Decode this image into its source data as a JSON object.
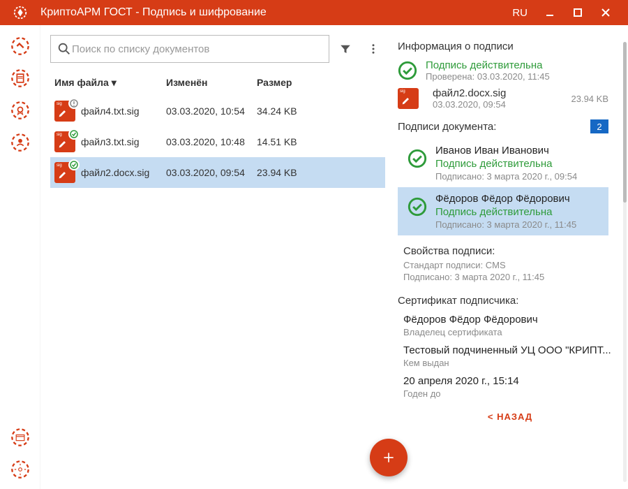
{
  "window": {
    "title": "КриптоАРМ ГОСТ - Подпись и шифрование",
    "language": "RU"
  },
  "search": {
    "placeholder": "Поиск по списку документов"
  },
  "columns": {
    "name": "Имя файла",
    "modified": "Изменён",
    "size": "Размер"
  },
  "files": [
    {
      "name": "файл4.txt.sig",
      "modified": "03.03.2020, 10:54",
      "size": "34.24 KB",
      "status": "unknown"
    },
    {
      "name": "файл3.txt.sig",
      "modified": "03.03.2020, 10:48",
      "size": "14.51 KB",
      "status": "valid"
    },
    {
      "name": "файл2.docx.sig",
      "modified": "03.03.2020, 09:54",
      "size": "23.94 KB",
      "status": "valid"
    }
  ],
  "info": {
    "heading": "Информация о подписи",
    "validLabel": "Подпись действительна",
    "checkedLabel": "Проверена: 03.03.2020, 11:45",
    "file": {
      "name": "файл2.docx.sig",
      "date": "03.03.2020, 09:54",
      "size": "23.94 KB"
    },
    "docSignaturesHeading": "Подписи документа:",
    "signaturesCount": "2",
    "signers": [
      {
        "name": "Иванов Иван Иванович",
        "status": "Подпись действительна",
        "signed": "Подписано: 3 марта 2020 г., 09:54"
      },
      {
        "name": "Фёдоров Фёдор Фёдорович",
        "status": "Подпись действительна",
        "signed": "Подписано: 3 марта 2020 г., 11:45"
      }
    ],
    "propsHeading": "Свойства подписи:",
    "standard": "Стандарт подписи: CMS",
    "signed": "Подписано: 3 марта 2020 г., 11:45",
    "certHeading": "Сертификат подписчика:",
    "cert": {
      "owner": "Фёдоров Фёдор Фёдорович",
      "ownerLabel": "Владелец сертификата",
      "issuer": "Тестовый подчиненный УЦ ООО \"КРИПТ...",
      "issuerLabel": "Кем выдан",
      "expires": "20 апреля 2020 г., 15:14",
      "expiresLabel": "Годен до"
    },
    "back": "< НАЗАД"
  }
}
